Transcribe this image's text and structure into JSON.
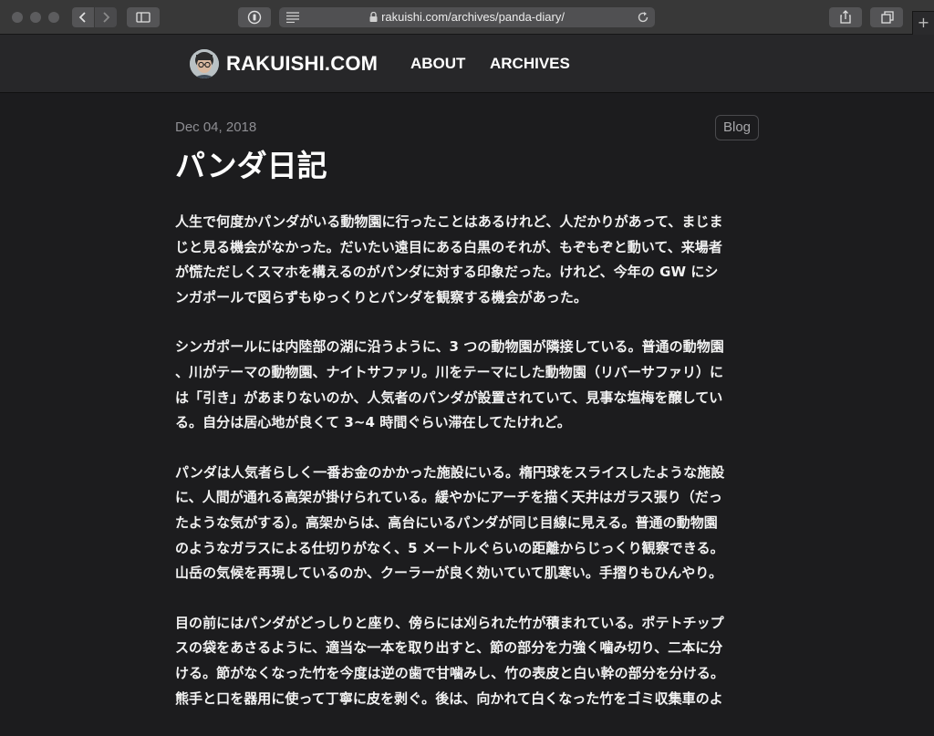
{
  "browser": {
    "url": "rakuishi.com/archives/panda-diary/",
    "new_tab_label": "+"
  },
  "site": {
    "brand": "RAKUISHI.COM",
    "nav": [
      {
        "label": "ABOUT"
      },
      {
        "label": "ARCHIVES"
      }
    ]
  },
  "post": {
    "date": "Dec 04, 2018",
    "category": "Blog",
    "title": "パンダ日記",
    "paragraphs": [
      "人生で何度かパンダがいる動物園に行ったことはあるけれど、人だかりがあって、まじま\nじと見る機会がなかった。だいたい遠目にある白黒のそれが、もぞもぞと動いて、来場者\nが慌ただしくスマホを構えるのがパンダに対する印象だった。けれど、今年の GW にシ\nンガポールで図らずもゆっくりとパンダを観察する機会があった。",
      "シンガポールには内陸部の湖に沿うように、3 つの動物園が隣接している。普通の動物園\n、川がテーマの動物園、ナイトサファリ。川をテーマにした動物園（リバーサファリ）に\nは「引き」があまりないのか、人気者のパンダが設置されていて、見事な塩梅を醸してい\nる。自分は居心地が良くて 3~4 時間ぐらい滞在してたけれど。",
      "パンダは人気者らしく一番お金のかかった施設にいる。楕円球をスライスしたような施設\nに、人間が通れる高架が掛けられている。緩やかにアーチを描く天井はガラス張り（だっ\nたような気がする）。高架からは、高台にいるパンダが同じ目線に見える。普通の動物園\nのようなガラスによる仕切りがなく、5 メートルぐらいの距離からじっくり観察できる。\n山岳の気候を再現しているのか、クーラーが良く効いていて肌寒い。手摺りもひんやり。",
      "目の前にはパンダがどっしりと座り、傍らには刈られた竹が積まれている。ポテトチップ\nスの袋をあさるように、適当な一本を取り出すと、節の部分を力強く噛み切り、二本に分\nける。節がなくなった竹を今度は逆の歯で甘噛みし、竹の表皮と白い幹の部分を分ける。\n熊手と口を器用に使って丁寧に皮を剥ぐ。後は、向かれて白くなった竹をゴミ収集車のよ"
    ]
  }
}
